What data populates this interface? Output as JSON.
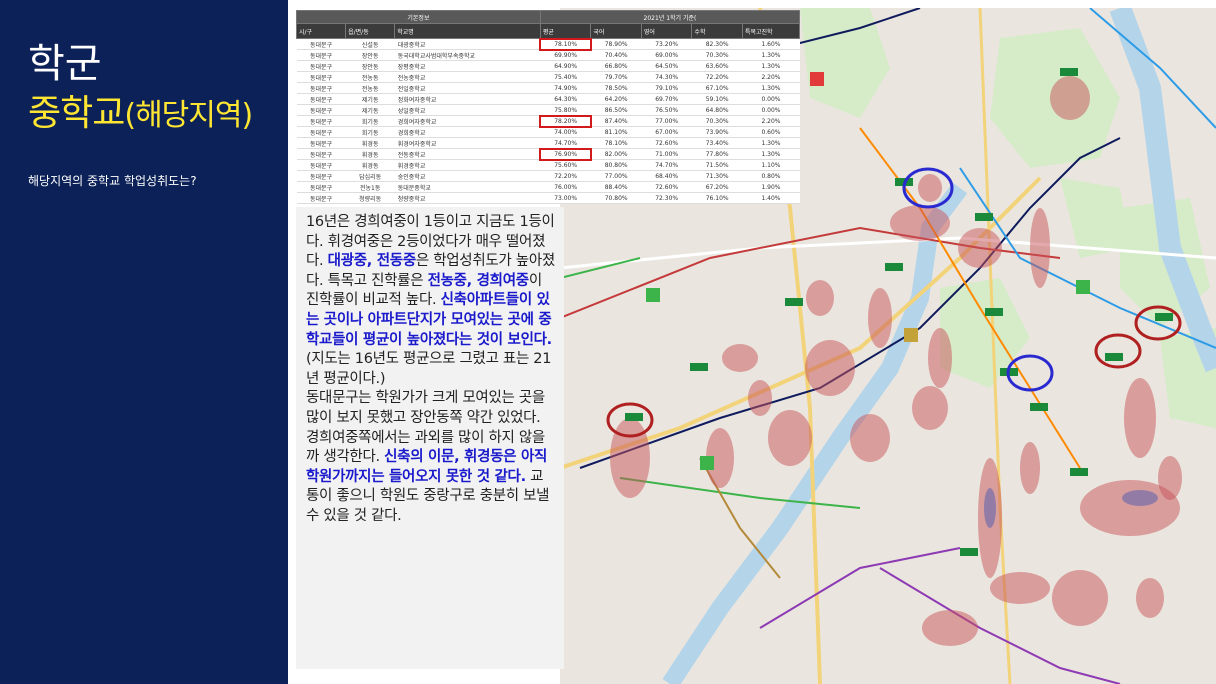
{
  "header": {
    "title_line1": "학군",
    "title_line2_main": "중학교",
    "title_line2_paren": "(해당지역)",
    "subtitle": "해당지역의 중학교 학업성취도는?"
  },
  "colors": {
    "left_panel": "#0c2157",
    "title_yellow": "#ffe633",
    "highlight_red": "#d21a1a",
    "emphasis_blue": "#1a1acc",
    "map_circle_red": "#c8545a",
    "map_circle_blue": "#2a2ad0"
  },
  "table": {
    "group_left": "기본정보",
    "group_right": "2021년 1학기 기준(",
    "columns": [
      "시/구",
      "읍/면/동",
      "학교명",
      "국어",
      "영어",
      "수학",
      "특목고진학"
    ],
    "avg_col": "평균",
    "rows": [
      [
        "동대문구",
        "신설동",
        "대광중학교",
        "78.10%",
        "78.90%",
        "73.20%",
        "82.30%",
        "1.60%"
      ],
      [
        "동대문구",
        "장안동",
        "동국대학교사범대학부속중학교",
        "69.90%",
        "70.40%",
        "69.00%",
        "70.30%",
        "1.30%"
      ],
      [
        "동대문구",
        "장안동",
        "장평중학교",
        "64.90%",
        "66.80%",
        "64.50%",
        "63.60%",
        "1.30%"
      ],
      [
        "동대문구",
        "전농동",
        "전농중학교",
        "75.40%",
        "79.70%",
        "74.30%",
        "72.20%",
        "2.20%"
      ],
      [
        "동대문구",
        "전농동",
        "전일중학교",
        "74.90%",
        "78.50%",
        "79.10%",
        "67.10%",
        "1.30%"
      ],
      [
        "동대문구",
        "제기동",
        "정화여자중학교",
        "64.30%",
        "64.20%",
        "69.70%",
        "59.10%",
        "0.00%"
      ],
      [
        "동대문구",
        "제기동",
        "성일중학교",
        "75.80%",
        "86.50%",
        "76.50%",
        "64.80%",
        "0.00%"
      ],
      [
        "동대문구",
        "회기동",
        "경희여자중학교",
        "78.20%",
        "87.40%",
        "77.00%",
        "70.30%",
        "2.20%"
      ],
      [
        "동대문구",
        "회기동",
        "경희중학교",
        "74.00%",
        "81.10%",
        "67.00%",
        "73.90%",
        "0.60%"
      ],
      [
        "동대문구",
        "휘경동",
        "휘경여자중학교",
        "74.70%",
        "78.10%",
        "72.60%",
        "73.40%",
        "1.30%"
      ],
      [
        "동대문구",
        "휘경동",
        "전동중학교",
        "76.90%",
        "82.00%",
        "71.00%",
        "77.80%",
        "1.30%"
      ],
      [
        "동대문구",
        "휘경동",
        "휘경중학교",
        "75.60%",
        "80.80%",
        "74.70%",
        "71.50%",
        "1.10%"
      ],
      [
        "동대문구",
        "답십리동",
        "숭인중학교",
        "72.20%",
        "77.00%",
        "68.40%",
        "71.30%",
        "0.80%"
      ],
      [
        "동대문구",
        "전농1동",
        "동대문중학교",
        "76.00%",
        "88.40%",
        "72.60%",
        "67.20%",
        "1.90%"
      ],
      [
        "동대문구",
        "청량리동",
        "청량중학교",
        "73.00%",
        "70.80%",
        "72.30%",
        "76.10%",
        "1.40%"
      ]
    ],
    "highlighted_rows": [
      0,
      7,
      10
    ]
  },
  "text": {
    "p1_a": "16년은 경희여중이 1등이고 지금도 1등이다. 휘경여중은 2등이었다가 매우 떨어졌다. ",
    "p1_em1": "대광중, 전동중",
    "p1_b": "은 학업성취도가 높아졌다. 특목고 진학률은 ",
    "p1_em2": "전농중, 경희여중",
    "p1_c": "이 진학률이 비교적 높다. ",
    "p1_em3": "신축아파트들이 있는 곳이나 아파트단지가 모여있는 곳에 중학교들이 평균이 높아졌다는 것이 보인다.",
    "p2": "(지도는 16년도 평균으로 그렸고 표는 21년 평균이다.)",
    "p3": "동대문구는 학원가가 크게 모여있는 곳을 많이 보지 못했고 장안동쪽 약간 있었다. 경희여중쪽에서는 과외를 많이 하지 않을까 생각한다. ",
    "p3_em": "신축의 이문, 휘경동은 아직 학원가까지는 들어오지 못한 것 같다.",
    "p3_b": " 교통이 좋으니 학원도 중랑구로 충분히 보낼 수 있을 것 같다."
  }
}
